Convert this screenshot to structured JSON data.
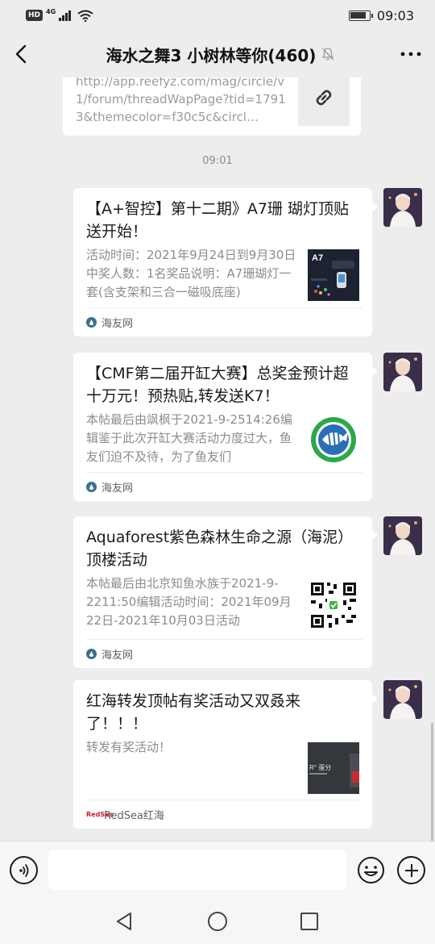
{
  "status_bar": {
    "hd": "HD",
    "network": "4G",
    "time": "09:03",
    "battery_level": 0.85
  },
  "header": {
    "title": "海水之舞3 小树林等你(460)"
  },
  "prev_link": {
    "text": "http://app.reefyz.com/mag/circle/v1/forum/threadWapPage?tid=17913&themecolor=f30c5c&circl…"
  },
  "chat": {
    "timestamp": "09:01",
    "messages": [
      {
        "title": "【A+智控】第十二期》A7珊 瑚灯顶贴送开始！",
        "desc": "活动时间：2021年9月24日到9月30日中奖人数：1名奖品说明：A7珊瑚灯一套(含支架和三合一磁吸底座)",
        "thumb_label": "A7",
        "source": "海友网"
      },
      {
        "title": "【CMF第二届开缸大赛】总奖金预计超十万元！预热贴,转发送K7！",
        "desc": "本帖最后由飒枫于2021-9-2514:26编辑鉴于此次开缸大赛活动力度过大，鱼友们迫不及待，为了鱼友们",
        "source": "海友网"
      },
      {
        "title": "Aquaforest紫色森林生命之源（海泥）顶楼活动",
        "desc": "本帖最后由北京知鱼水族于2021-9-2211:50编辑活动时间：2021年09月22日-2021年10月03日活动",
        "source": "海友网"
      },
      {
        "title": "红海转发顶帖有奖活动又双叒来了！！！",
        "desc": "转发有奖活动！",
        "thumb_label": "R° 蛋分",
        "source_icon": "RedSea",
        "source": "RedSea红海"
      }
    ]
  },
  "input": {
    "placeholder": ""
  },
  "colors": {
    "bg": "#ededed",
    "bubble": "#ffffff",
    "muted": "#8c8c8c",
    "accent_red": "#c7202d"
  }
}
